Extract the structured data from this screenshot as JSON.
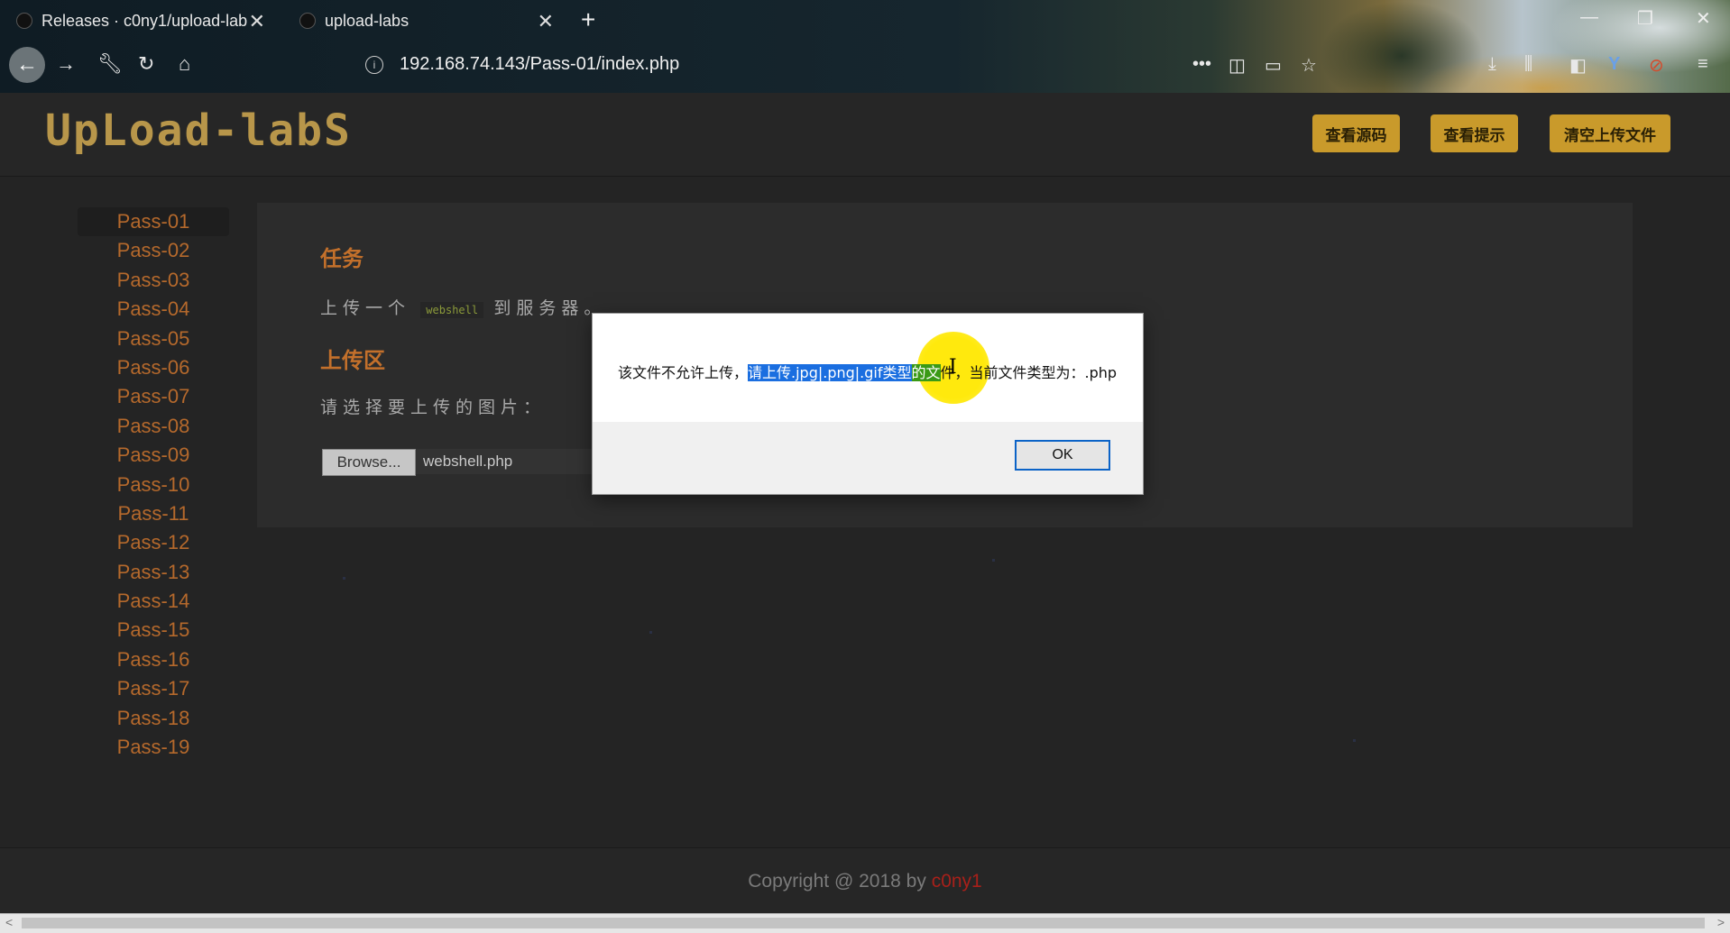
{
  "browser": {
    "tabs": [
      {
        "title": "Releases · c0ny1/upload-lab",
        "active": false
      },
      {
        "title": "upload-labs",
        "active": true
      }
    ],
    "url": "192.168.74.143/Pass-01/index.php",
    "icons": [
      "back-icon",
      "forward-icon",
      "wrench-icon",
      "reload-icon",
      "home-icon",
      "info-icon",
      "more-icon",
      "pocket-icon",
      "reader-icon",
      "star-icon",
      "download-icon",
      "library-icon",
      "sidebar-icon",
      "yandex-icon",
      "noscript-icon",
      "menu-icon"
    ]
  },
  "header": {
    "logo": "UpLoad-labS",
    "buttons": [
      "查看源码",
      "查看提示",
      "清空上传文件"
    ],
    "accent": "#c99a2b"
  },
  "sidebar": {
    "items": [
      "Pass-01",
      "Pass-02",
      "Pass-03",
      "Pass-04",
      "Pass-05",
      "Pass-06",
      "Pass-07",
      "Pass-08",
      "Pass-09",
      "Pass-10",
      "Pass-11",
      "Pass-12",
      "Pass-13",
      "Pass-14",
      "Pass-15",
      "Pass-16",
      "Pass-17",
      "Pass-18",
      "Pass-19"
    ],
    "active": "Pass-01",
    "color": "#b5692c"
  },
  "main": {
    "task_heading": "任务",
    "task_before": "上传一个",
    "task_code": "webshell",
    "task_after": "到服务器。",
    "upload_heading": "上传区",
    "choose_label": "请选择要上传的图片：",
    "browse_label": "Browse...",
    "file_value": "webshell.php"
  },
  "dialog": {
    "msg_prefix": "该文件不允许上传，",
    "msg_selected": "请上传.jpg|.png|.gif类型",
    "msg_selected2": "的文",
    "msg_suffix": "件，当前文件类型为：.php",
    "ok_label": "OK"
  },
  "footer": {
    "copyright": "Copyright @ 2018 by",
    "author": "c0ny1"
  }
}
